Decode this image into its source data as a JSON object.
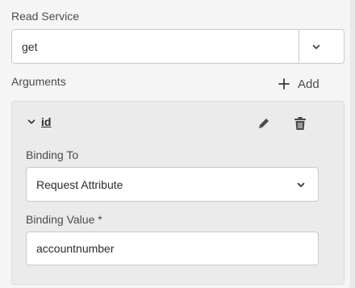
{
  "read_service": {
    "label": "Read Service",
    "value": "get"
  },
  "arguments": {
    "label": "Arguments",
    "add_label": "Add",
    "items": [
      {
        "name": "id",
        "binding_to": {
          "label": "Binding To",
          "value": "Request Attribute"
        },
        "binding_value": {
          "label": "Binding Value *",
          "value": "accountnumber"
        }
      }
    ]
  },
  "icons": {
    "chevron": "chevron-down-icon",
    "add": "plus-icon",
    "edit": "pencil-icon",
    "delete": "trash-icon"
  },
  "colors": {
    "background": "#f5f5f5",
    "panel": "#ebebeb",
    "border": "#c9c9c9",
    "text": "#2c2c2c",
    "label": "#4b4b4b"
  }
}
